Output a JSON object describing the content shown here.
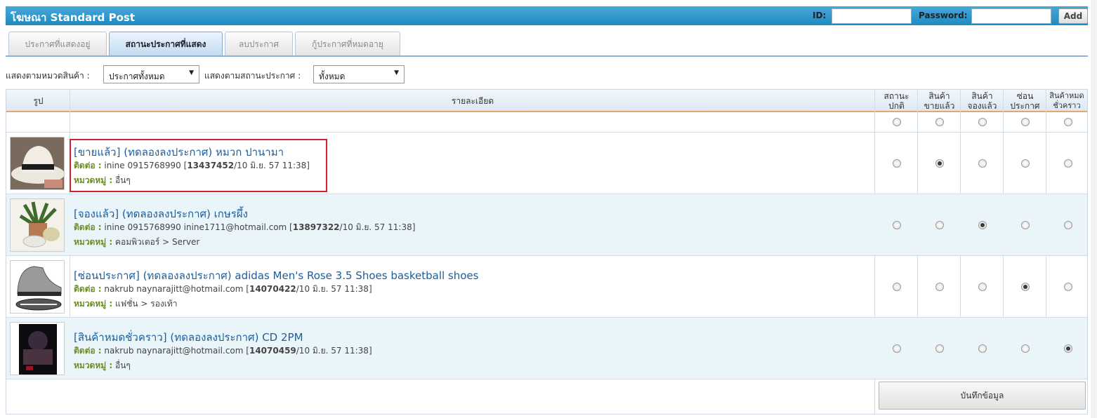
{
  "header": {
    "title": "โฆษณา Standard Post",
    "id_label": "ID:",
    "password_label": "Password:",
    "id_value": "",
    "password_value": "",
    "add_label": "Add"
  },
  "tabs": [
    {
      "label": "ประกาศที่แสดงอยู่",
      "active": false
    },
    {
      "label": "สถานะประกาศที่แสดง",
      "active": true
    },
    {
      "label": "ลบประกาศ",
      "active": false
    },
    {
      "label": "กู้ประกาศที่หมดอายุ",
      "active": false
    }
  ],
  "filters": {
    "category_label": "แสดงตามหมวดสินค้า :",
    "category_value": "ประกาศทั้งหมด",
    "status_label": "แสดงตามสถานะประกาศ :",
    "status_value": "ทั้งหมด"
  },
  "table": {
    "headers": {
      "image": "รูป",
      "detail": "รายละเอียด",
      "normal": [
        "สถานะ",
        "ปกติ"
      ],
      "sold": [
        "สินค้า",
        "ขายแล้ว"
      ],
      "reserved": [
        "สินค้า",
        "จองแล้ว"
      ],
      "hidden": [
        "ซ่อน",
        "ประกาศ"
      ],
      "out": [
        "สินค้าหมด",
        "ชั่วคราว"
      ]
    },
    "contact_label": "ติดต่อ :",
    "category_label": "หมวดหมู่ :",
    "rows": [
      {
        "title": "[ขายแล้ว] (ทดลองลงประกาศ) หมวก ปานามา",
        "contact": "inine 0915768990 [",
        "id": "13437452",
        "date": "/10 มิ.ย. 57 11:38]",
        "category": "อื่นๆ",
        "status": "sold"
      },
      {
        "title": "[จองแล้ว] (ทดลองลงประกาศ) เกษรผึ้ง",
        "contact": "inine 0915768990 inine1711@hotmail.com [",
        "id": "13897322",
        "date": "/10 มิ.ย. 57 11:38]",
        "category": "คอมพิวเตอร์ > Server",
        "status": "reserved"
      },
      {
        "title": "[ซ่อนประกาศ] (ทดลองลงประกาศ) adidas Men's Rose 3.5 Shoes basketball shoes",
        "contact": "nakrub naynarajitt@hotmail.com [",
        "id": "14070422",
        "date": "/10 มิ.ย. 57 11:38]",
        "category": "แฟชั่น > รองเท้า",
        "status": "hidden"
      },
      {
        "title": "[สินค้าหมดชั่วคราว] (ทดลองลงประกาศ) CD 2PM",
        "contact": "nakrub naynarajitt@hotmail.com [",
        "id": "14070459",
        "date": "/10 มิ.ย. 57 11:38]",
        "category": "อื่นๆ",
        "status": "out"
      }
    ],
    "save_label": "บันทึกข้อมูล"
  },
  "colors": {
    "header_bar": "#1f8ac2",
    "link": "#1d5d9b",
    "label_green": "#6b8e23",
    "highlight": "#d0212e",
    "row_alt": "#eaf5fa"
  }
}
